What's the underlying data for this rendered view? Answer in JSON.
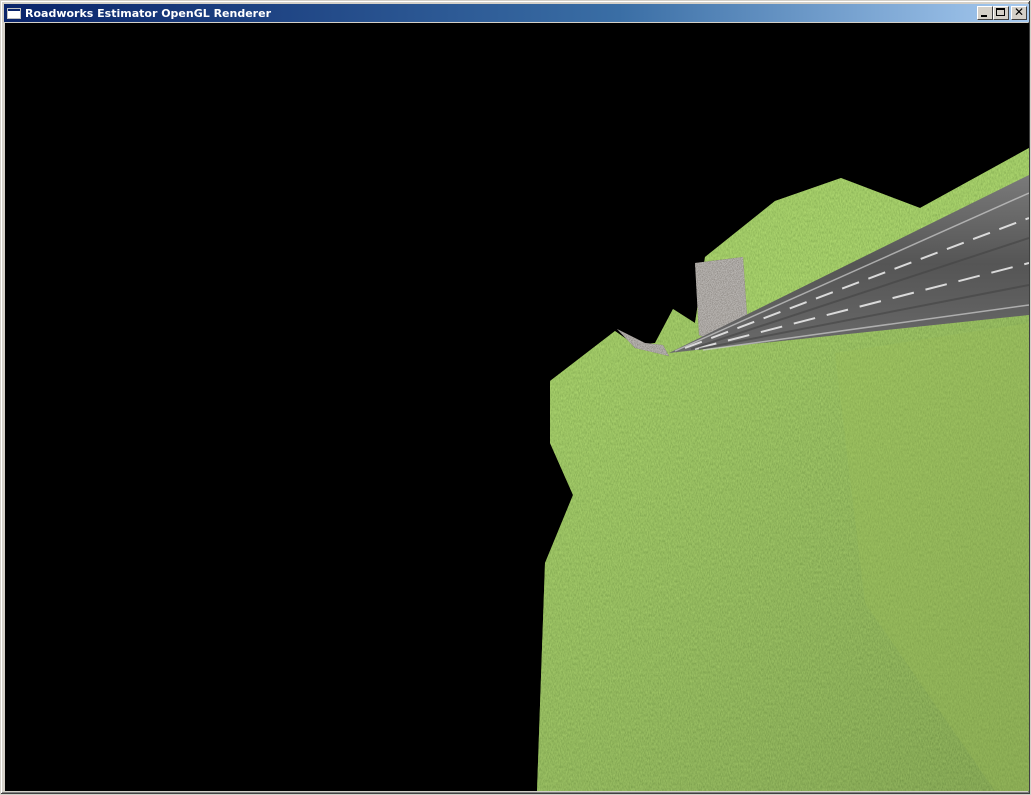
{
  "window": {
    "title": "Roadworks Estimator OpenGL Renderer",
    "icon": "application-icon",
    "controls": {
      "minimize_icon": "minimize-icon",
      "maximize_icon": "maximize-icon",
      "close_icon": "close-icon",
      "close_glyph": "✕"
    }
  },
  "scene": {
    "background_color": "#000000",
    "grass_color": "#6a8f2e",
    "road_color": "#5a5a5a",
    "lane_marking_color": "#e8e8e8",
    "soil_color": "#4a4238"
  }
}
